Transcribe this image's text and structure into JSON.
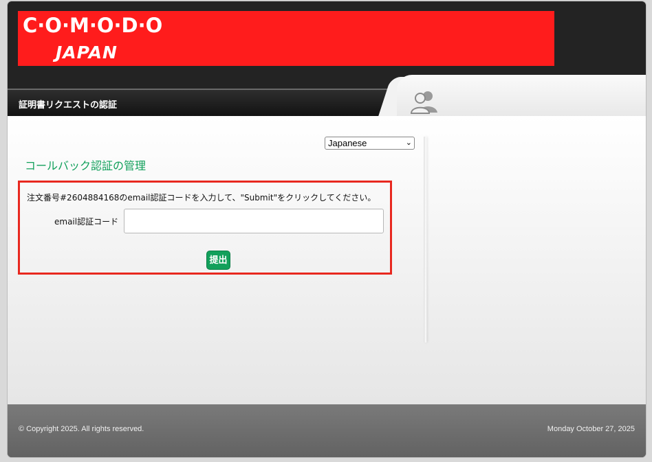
{
  "header": {
    "logo_main": "C·O·M·O·D·O",
    "logo_sub": "JAPAN"
  },
  "page_title": "証明書リクエストの認証",
  "language_select": {
    "selected": "Japanese"
  },
  "section_title": "コールバック認証の管理",
  "form": {
    "instruction": "注文番号#2604884168のemail認証コードを入力して、\"Submit\"をクリックしてください。",
    "code_label": "email認証コード",
    "code_value": "",
    "submit_label": "提出"
  },
  "footer": {
    "copyright": "© Copyright 2025. All rights reserved.",
    "date": "Monday October 27, 2025"
  },
  "colors": {
    "brand_red": "#ff1c1c",
    "accent_green": "#12a05b",
    "highlight_border": "#e8281f"
  },
  "icons": {
    "users": "users-icon",
    "dropdown": "chevron-down-icon"
  }
}
